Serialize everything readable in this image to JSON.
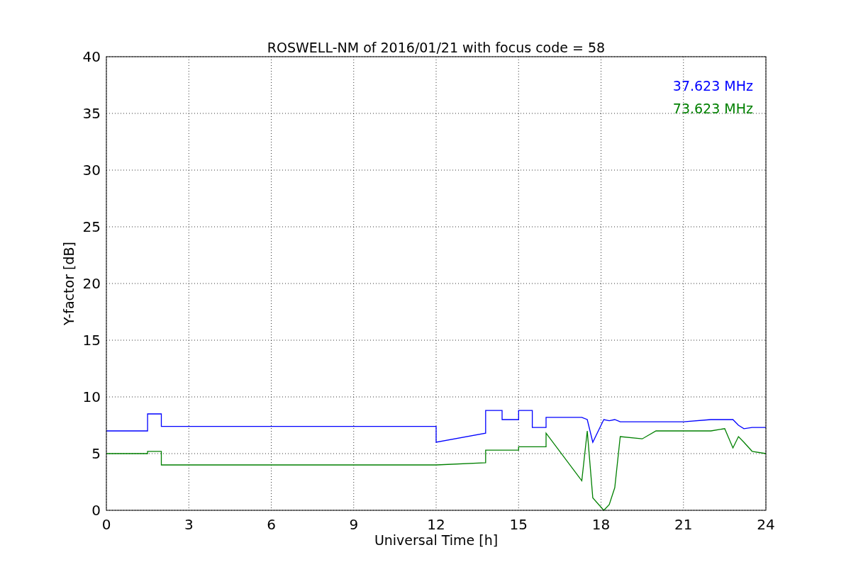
{
  "chart_data": {
    "type": "line",
    "title": "ROSWELL-NM of 2016/01/21 with focus code = 58",
    "xlabel": "Universal Time [h]",
    "ylabel": "Y-factor [dB]",
    "x": [
      0,
      1.5,
      1.5,
      2,
      2,
      12,
      12,
      13.8,
      13.8,
      14.4,
      14.4,
      15,
      15,
      15.5,
      15.5,
      16,
      16,
      17.3,
      17.5,
      17.7,
      18.1,
      18.3,
      18.5,
      18.7,
      19.5,
      20,
      21,
      22,
      22.5,
      22.8,
      23,
      23.2,
      23.5,
      24
    ],
    "series": [
      {
        "name": "37.623 MHz",
        "color": "#0000ff",
        "values": [
          7.0,
          7.0,
          8.5,
          8.5,
          7.4,
          7.4,
          6.0,
          6.8,
          8.8,
          8.8,
          8.0,
          8.0,
          8.8,
          8.8,
          7.3,
          7.3,
          8.2,
          8.2,
          8.0,
          6.0,
          8.0,
          7.9,
          8.0,
          7.8,
          7.8,
          7.8,
          7.8,
          8.0,
          8.0,
          8.0,
          7.5,
          7.2,
          7.3,
          7.3
        ]
      },
      {
        "name": "73.623 MHz",
        "color": "#008000",
        "values": [
          5.0,
          5.0,
          5.2,
          5.2,
          4.0,
          4.0,
          4.0,
          4.2,
          5.3,
          5.3,
          5.3,
          5.3,
          5.6,
          5.6,
          5.6,
          5.6,
          6.8,
          2.6,
          7.0,
          1.1,
          0.0,
          0.5,
          2.0,
          6.5,
          6.3,
          7.0,
          7.0,
          7.0,
          7.2,
          5.5,
          6.5,
          6.0,
          5.2,
          5.0
        ]
      }
    ],
    "xlim": [
      0,
      24
    ],
    "ylim": [
      0,
      40
    ],
    "xticks": [
      0,
      3,
      6,
      9,
      12,
      15,
      18,
      21,
      24
    ],
    "yticks": [
      0,
      5,
      10,
      15,
      20,
      25,
      30,
      35,
      40
    ],
    "grid": true
  }
}
